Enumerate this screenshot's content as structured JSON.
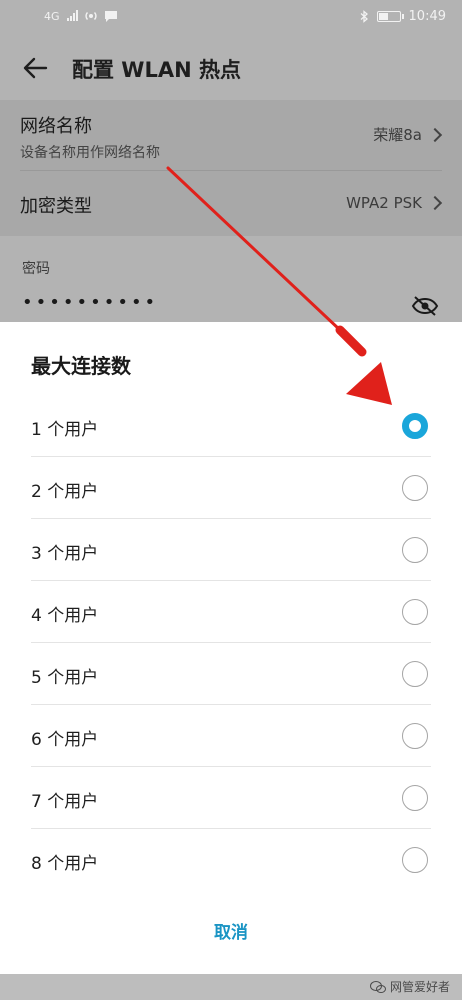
{
  "status_bar": {
    "network": "4G",
    "time": "10:49"
  },
  "header": {
    "title": "配置 WLAN 热点"
  },
  "settings": {
    "network_name": {
      "title": "网络名称",
      "subtitle": "设备名称用作网络名称",
      "value": "荣耀8a"
    },
    "encryption": {
      "title": "加密类型",
      "value": "WPA2 PSK"
    },
    "password": {
      "label": "密码",
      "masked_value": "••••••••••"
    }
  },
  "dialog": {
    "title": "最大连接数",
    "options": [
      {
        "label": "1 个用户",
        "selected": true
      },
      {
        "label": "2 个用户",
        "selected": false
      },
      {
        "label": "3 个用户",
        "selected": false
      },
      {
        "label": "4 个用户",
        "selected": false
      },
      {
        "label": "5 个用户",
        "selected": false
      },
      {
        "label": "6 个用户",
        "selected": false
      },
      {
        "label": "7 个用户",
        "selected": false
      },
      {
        "label": "8 个用户",
        "selected": false
      }
    ],
    "cancel_label": "取消"
  },
  "watermark": {
    "text": "网管爱好者"
  },
  "colors": {
    "accent": "#1aa6da",
    "cancel": "#1a94c4",
    "annotation_arrow": "#e0211b"
  }
}
